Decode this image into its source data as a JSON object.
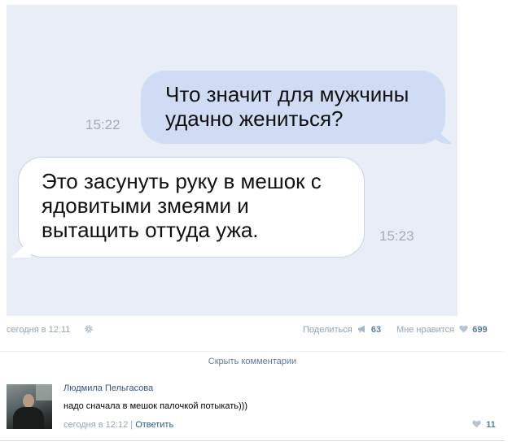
{
  "chat": {
    "outgoing": {
      "line1": "Что значит для мужчины",
      "line2": "удачно жениться?",
      "time": "15:22"
    },
    "incoming": {
      "line1": "Это засунуть руку в мешок с",
      "line2": "ядовитыми змеями и",
      "line3": "вытащить оттуда ужа.",
      "time": "15:23"
    }
  },
  "post": {
    "date": "сегодня в 12:11",
    "share_label": "Поделиться",
    "share_count": "63",
    "like_label": "Мне нравится",
    "like_count": "699",
    "hide_comments": "Скрыть комментарии"
  },
  "comment": {
    "author": "Людмила Пельгасова",
    "text": "надо сначала в мешок палочкой потыкать)))",
    "date": "сегодня в 12:12",
    "separator": "|",
    "reply": "Ответить",
    "likes": "11"
  },
  "icons": {
    "gear": "gear-icon",
    "share": "megaphone-icon",
    "like": "heart-icon"
  },
  "colors": {
    "chat_background": "#e8edf6",
    "outgoing_bubble": "#cfdcf4",
    "incoming_bubble": "#ffffff",
    "link": "#2f5686",
    "meta": "#93a3b8"
  }
}
